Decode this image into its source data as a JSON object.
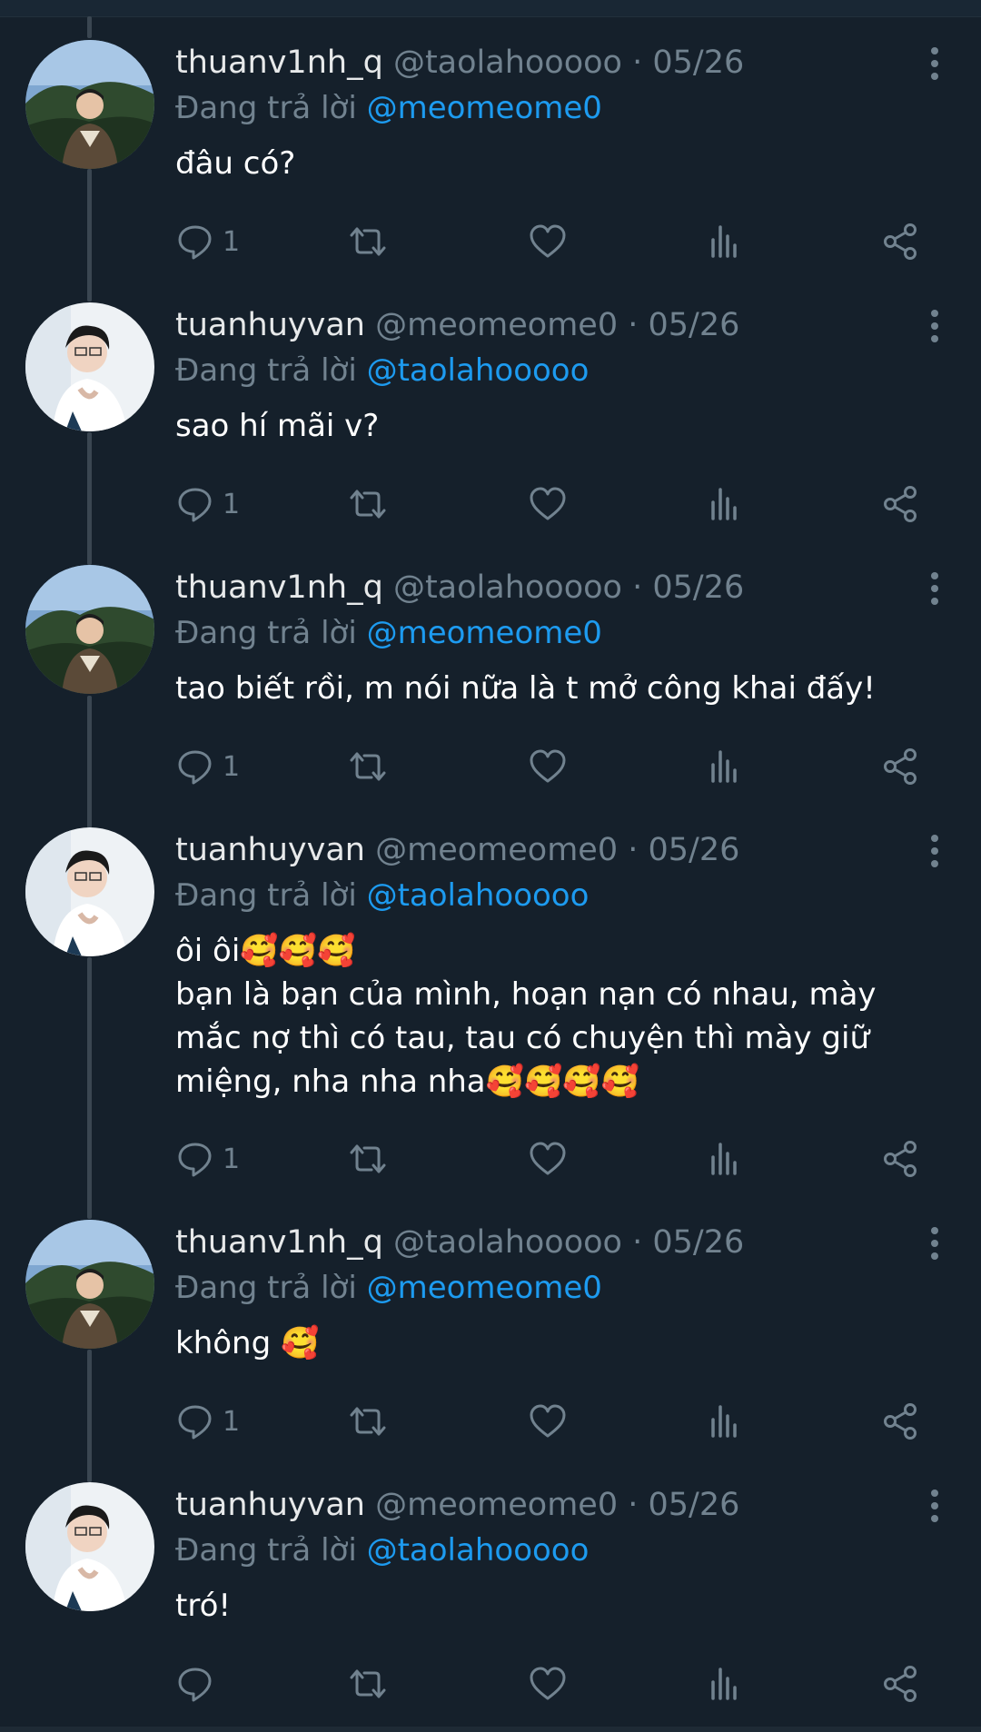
{
  "reply_prefix": "Đang trả lời",
  "icons": {
    "reply": "reply-icon",
    "retweet": "retweet-icon",
    "like": "heart-icon",
    "views": "analytics-icon",
    "share": "share-icon",
    "more": "more-vertical-icon"
  },
  "colors": {
    "background": "#15202b",
    "mention": "#1d9bf0",
    "muted": "#71828f",
    "thread_line": "#3a4651"
  },
  "tweets": [
    {
      "name": "thuanv1nh_q",
      "handle": "@taolahooooo",
      "separator": "·",
      "date": "05/26",
      "reply_to": "@meomeome0",
      "text": "đâu có?",
      "reply_count": "1",
      "avatar": "avatar-thuanv1nh"
    },
    {
      "name": "tuanhuyvan",
      "handle": "@meomeome0",
      "separator": "·",
      "date": "05/26",
      "reply_to": "@taolahooooo",
      "text": "sao hí mãi v?",
      "reply_count": "1",
      "avatar": "avatar-tuanhuyvan"
    },
    {
      "name": "thuanv1nh_q",
      "handle": "@taolahooooo",
      "separator": "·",
      "date": "05/26",
      "reply_to": "@meomeome0",
      "text": "tao biết rồi, m nói nữa là t mở công khai đấy!",
      "reply_count": "1",
      "avatar": "avatar-thuanv1nh"
    },
    {
      "name": "tuanhuyvan",
      "handle": "@meomeome0",
      "separator": "·",
      "date": "05/26",
      "reply_to": "@taolahooooo",
      "text": "ôi ôi🥰🥰🥰\nbạn là bạn của mình, hoạn nạn có nhau, mày mắc nợ thì có tau, tau có chuyện thì mày giữ miệng, nha nha nha🥰🥰🥰🥰",
      "reply_count": "1",
      "avatar": "avatar-tuanhuyvan"
    },
    {
      "name": "thuanv1nh_q",
      "handle": "@taolahooooo",
      "separator": "·",
      "date": "05/26",
      "reply_to": "@meomeome0",
      "text": "không 🥰",
      "reply_count": "1",
      "avatar": "avatar-thuanv1nh"
    },
    {
      "name": "tuanhuyvan",
      "handle": "@meomeome0",
      "separator": "·",
      "date": "05/26",
      "reply_to": "@taolahooooo",
      "text": "tró!",
      "reply_count": "",
      "avatar": "avatar-tuanhuyvan"
    }
  ]
}
